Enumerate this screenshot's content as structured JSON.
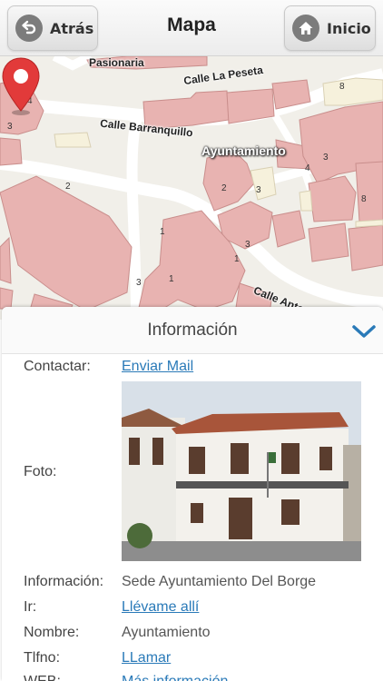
{
  "header": {
    "back_label": "Atrás",
    "title": "Mapa",
    "home_label": "Inicio"
  },
  "map": {
    "streets": {
      "pasionaria": "Pasionaria",
      "peseta": "Calle La Peseta",
      "barranquillo": "Calle Barranquillo",
      "antonio_machado": "Calle Antonio Machado"
    },
    "place_label": "Ayuntamiento",
    "house_numbers": [
      "4",
      "3",
      "8",
      "3",
      "2",
      "4",
      "3",
      "2",
      "1",
      "1",
      "3",
      "1",
      "3",
      "8"
    ],
    "colors": {
      "building": "#e8b3b1",
      "building_edge": "#c98e8c",
      "road": "#ffffff",
      "ground": "#f1efe9",
      "pin": "#e23a3a"
    }
  },
  "info": {
    "title": "Información",
    "rows": {
      "contact_label": "Contactar:",
      "contact_value": "Enviar Mail",
      "photo_label": "Foto:",
      "info_label": "Información:",
      "info_value": "Sede Ayuntamiento Del Borge",
      "go_label": "Ir:",
      "go_value": "Llévame allí",
      "name_label": "Nombre:",
      "name_value": "Ayuntamiento",
      "phone_label": "Tlfno:",
      "phone_value": "LLamar",
      "web_label": "WEB:",
      "web_value": "Más información"
    },
    "accent_color": "#2a7ab8"
  }
}
